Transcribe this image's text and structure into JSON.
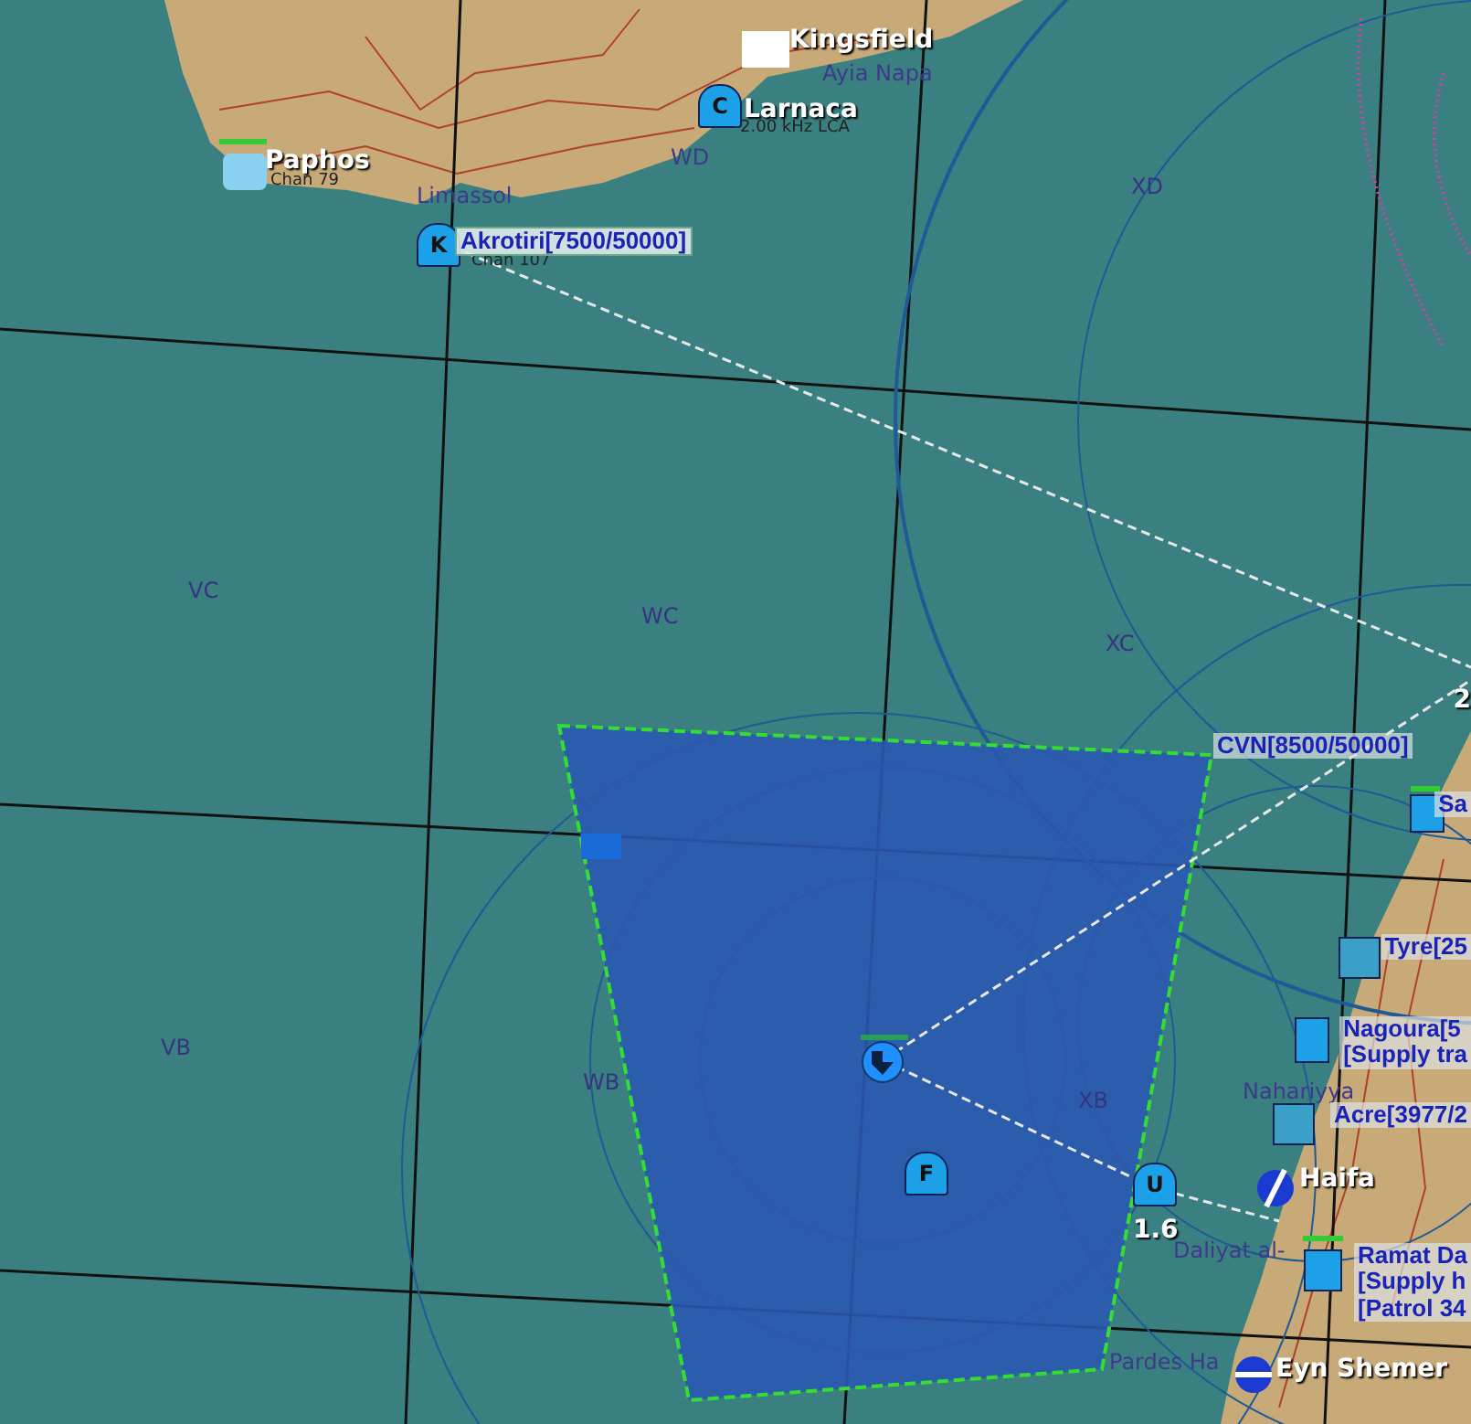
{
  "map": {
    "grid_labels": [
      "XD",
      "VC",
      "WC",
      "XC",
      "VB",
      "WB",
      "XB"
    ],
    "place_names": [
      "Ayia Napa",
      "WD",
      "Limassol",
      "Nahariyya",
      "Daliyat al-",
      "Pardes Ha"
    ],
    "airfields": [
      "Kingsfield",
      "Larnaca",
      "Paphos",
      "Haifa",
      "Eyn Shemer"
    ],
    "frequencies": [
      "2.00 kHz LCA",
      "Chan 79",
      "Chan 107"
    ],
    "groups": [
      {
        "lines": [
          "Akrotiri[7500/50000]"
        ],
        "selected": true
      },
      {
        "lines": [
          "CVN[8500/50000]"
        ],
        "selected": false
      },
      {
        "lines": [
          "Sa"
        ],
        "selected": false
      },
      {
        "lines": [
          "Tyre[25"
        ],
        "selected": false
      },
      {
        "lines": [
          "Nagoura[5",
          "[Supply tra"
        ],
        "selected": false
      },
      {
        "lines": [
          "Acre[3977/2"
        ],
        "selected": false
      },
      {
        "lines": [
          "Ramat Da",
          "[Supply h",
          "[Patrol 34"
        ],
        "selected": false
      }
    ],
    "unit_letters": [
      "C",
      "K",
      "F",
      "U"
    ],
    "readouts": [
      "1.6",
      "2"
    ]
  }
}
